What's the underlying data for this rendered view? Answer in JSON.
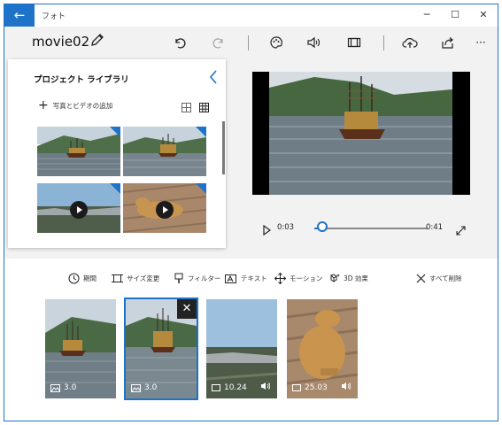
{
  "titlebar": {
    "app_title": "フォト",
    "back_label": "←",
    "minimize_label": "─",
    "maximize_label": "☐",
    "close_label": "✕"
  },
  "header": {
    "project_name": "movie02",
    "more_label": "···"
  },
  "library": {
    "title": "プロジェクト ライブラリ",
    "add_label": "写真とビデオの追加",
    "add_symbol": "+",
    "collapse_symbol": "‹",
    "items": [
      {
        "kind": "photo",
        "scene": "ship",
        "selected_flag": true
      },
      {
        "kind": "photo",
        "scene": "ship-close",
        "selected_flag": true
      },
      {
        "kind": "video",
        "scene": "town",
        "selected_flag": true
      },
      {
        "kind": "video",
        "scene": "dog",
        "selected_flag": true
      }
    ]
  },
  "player": {
    "current_time": "0:03",
    "duration": "0:41",
    "progress_fraction": 0.07
  },
  "toolbar": {
    "duration": "期間",
    "resize": "サイズ変更",
    "filters": "フィルター",
    "text": "テキスト",
    "motion": "モーション",
    "effects_3d": "3D 効果",
    "remove_all": "すべて削除"
  },
  "storyboard": {
    "cards": [
      {
        "label": "3.0",
        "kind": "photo",
        "audio": false
      },
      {
        "label": "3.0",
        "kind": "photo",
        "audio": false,
        "selected": true,
        "close_symbol": "✕"
      },
      {
        "label": "10.24",
        "kind": "video",
        "audio": true
      },
      {
        "label": "25.03",
        "kind": "video",
        "audio": true
      }
    ]
  },
  "colors": {
    "accent": "#1e73c8",
    "background": "#f2f2f2",
    "panel": "#ffffff"
  }
}
